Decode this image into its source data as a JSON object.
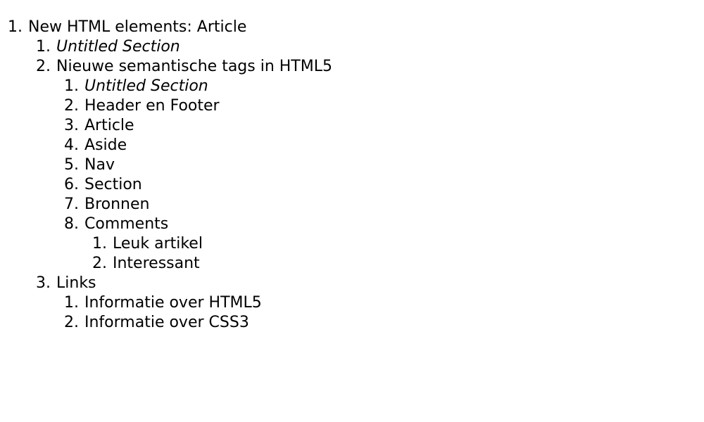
{
  "outline": [
    {
      "number": "1.",
      "label": "New HTML elements: Article",
      "level": 0,
      "italic": false,
      "name": "outline-item-new-html-elements-article"
    },
    {
      "number": "1.",
      "label": "Untitled Section",
      "level": 1,
      "italic": true,
      "name": "outline-item-untitled-section"
    },
    {
      "number": "2.",
      "label": "Nieuwe semantische tags in HTML5",
      "level": 1,
      "italic": false,
      "name": "outline-item-nieuwe-semantische-tags"
    },
    {
      "number": "1.",
      "label": "Untitled Section",
      "level": 2,
      "italic": true,
      "name": "outline-item-untitled-section-2"
    },
    {
      "number": "2.",
      "label": "Header en Footer",
      "level": 2,
      "italic": false,
      "name": "outline-item-header-en-footer"
    },
    {
      "number": "3.",
      "label": "Article",
      "level": 2,
      "italic": false,
      "name": "outline-item-article"
    },
    {
      "number": "4.",
      "label": "Aside",
      "level": 2,
      "italic": false,
      "name": "outline-item-aside"
    },
    {
      "number": "5.",
      "label": "Nav",
      "level": 2,
      "italic": false,
      "name": "outline-item-nav"
    },
    {
      "number": "6.",
      "label": "Section",
      "level": 2,
      "italic": false,
      "name": "outline-item-section"
    },
    {
      "number": "7.",
      "label": "Bronnen",
      "level": 2,
      "italic": false,
      "name": "outline-item-bronnen"
    },
    {
      "number": "8.",
      "label": "Comments",
      "level": 2,
      "italic": false,
      "name": "outline-item-comments"
    },
    {
      "number": "1.",
      "label": "Leuk artikel",
      "level": 3,
      "italic": false,
      "name": "outline-item-leuk-artikel"
    },
    {
      "number": "2.",
      "label": "Interessant",
      "level": 3,
      "italic": false,
      "name": "outline-item-interessant"
    },
    {
      "number": "3.",
      "label": "Links",
      "level": 1,
      "italic": false,
      "name": "outline-item-links"
    },
    {
      "number": "1.",
      "label": "Informatie over HTML5",
      "level": 2,
      "italic": false,
      "name": "outline-item-informatie-over-html5"
    },
    {
      "number": "2.",
      "label": "Informatie over CSS3",
      "level": 2,
      "italic": false,
      "name": "outline-item-informatie-over-css3"
    }
  ]
}
